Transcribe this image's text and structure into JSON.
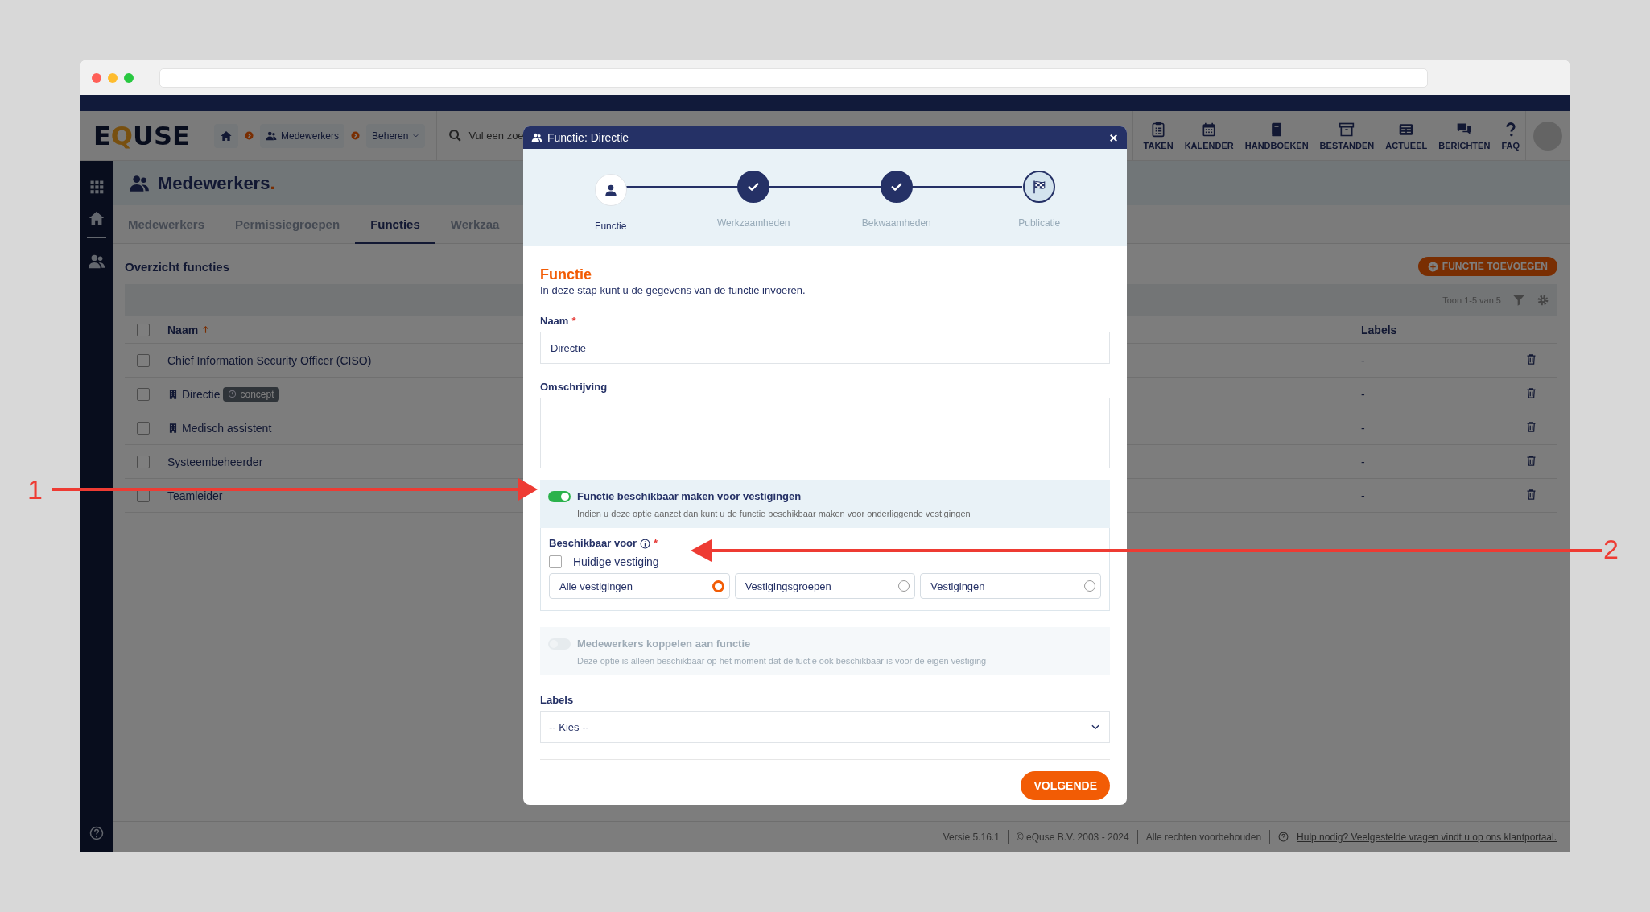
{
  "header": {
    "logo": "EQUSE",
    "breadcrumb": [
      {
        "label": "Medewerkers"
      },
      {
        "label": "Beheren"
      }
    ],
    "search": {
      "placeholder": "Vul een zoe"
    },
    "nav": [
      {
        "label": "TAKEN"
      },
      {
        "label": "KALENDER"
      },
      {
        "label": "HANDBOEKEN"
      },
      {
        "label": "BESTANDEN"
      },
      {
        "label": "ACTUEEL"
      },
      {
        "label": "BERICHTEN"
      },
      {
        "label": "FAQ"
      }
    ]
  },
  "page": {
    "title": "Medewerkers.",
    "tabs": [
      {
        "label": "Medewerkers",
        "selected": false
      },
      {
        "label": "Permissiegroepen",
        "selected": false
      },
      {
        "label": "Functies",
        "selected": true
      },
      {
        "label": "Werkzaa",
        "selected": false
      }
    ],
    "section_title": "Overzicht functies",
    "add_button": "FUNCTIE TOEVOEGEN",
    "pager": "Toon 1-5 van 5",
    "table": {
      "columns": [
        "Naam",
        "Labels"
      ],
      "select_all_checked": false,
      "rows": [
        {
          "name": "Chief Information Security Officer (CISO)",
          "kind": "plain",
          "labels": "-",
          "checked": false
        },
        {
          "name": "Directie",
          "kind": "location",
          "badge": "concept",
          "labels": "-",
          "checked": false
        },
        {
          "name": "Medisch assistent",
          "kind": "location",
          "labels": "-",
          "checked": false
        },
        {
          "name": "Systeembeheerder",
          "kind": "plain",
          "labels": "-",
          "checked": false
        },
        {
          "name": "Teamleider",
          "kind": "plain",
          "labels": "-",
          "checked": false
        }
      ]
    }
  },
  "footer": {
    "items": [
      "Versie 5.16.1",
      "© eQuse B.V. 2003 - 2024",
      "Alle rechten voorbehouden"
    ],
    "help_link": "Hulp nodig? Veelgestelde vragen vindt u op ons klantportaal."
  },
  "modal": {
    "title": "Functie: Directie",
    "steps": [
      {
        "label": "Functie",
        "selected": true,
        "completed": false
      },
      {
        "label": "Werkzaamheden",
        "selected": false,
        "completed": true
      },
      {
        "label": "Bekwaamheden",
        "selected": false,
        "completed": true
      },
      {
        "label": "Publicatie",
        "selected": false,
        "completed": false
      }
    ],
    "heading": "Functie",
    "intro": "In deze stap kunt u de gegevens van de functie invoeren.",
    "name_field": {
      "label": "Naam",
      "required_mark": "*",
      "value": "Directie"
    },
    "description_field": {
      "label": "Omschrijving"
    },
    "toggles": [
      {
        "title": "Functie beschikbaar maken voor vestigingen",
        "hint": "Indien u deze optie aanzet dan kunt u de functie beschikbaar maken voor onderliggende vestigingen",
        "on": true,
        "disabled": false
      },
      {
        "title": "Medewerkers koppelen aan functie",
        "hint": "Deze optie is alleen beschikbaar op het moment dat de fuctie ook beschikbaar is voor de eigen vestiging",
        "on": false,
        "disabled": true
      }
    ],
    "availability": {
      "label": "Beschikbaar voor",
      "required_mark": "*",
      "current": {
        "label": "Huidige vestiging",
        "checked": false
      },
      "options": [
        {
          "label": "Alle vestigingen",
          "selected": true
        },
        {
          "label": "Vestigingsgroepen",
          "selected": false
        },
        {
          "label": "Vestigingen",
          "selected": false
        }
      ]
    },
    "labels_field": {
      "label": "Labels",
      "value": "-- Kies --"
    },
    "next_button": "VOLGENDE"
  },
  "annotations": [
    {
      "label": "1"
    },
    {
      "label": "2"
    }
  ]
}
